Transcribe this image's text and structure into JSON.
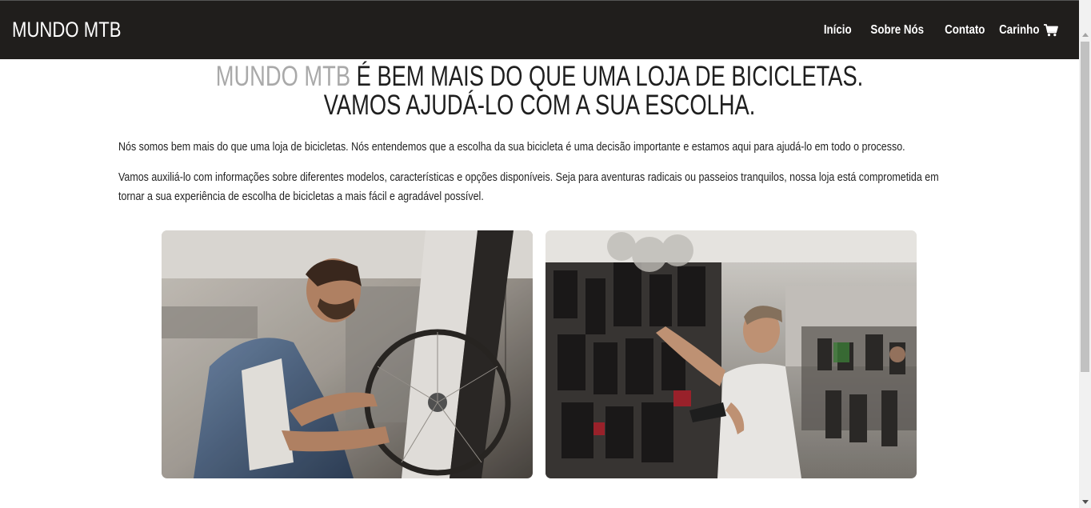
{
  "nav": {
    "brand": "MUNDO MTB",
    "links": [
      "Início",
      "Sobre Nós",
      "Contato"
    ],
    "cart_label": "Carinho",
    "cart_icon": "shopping-cart-icon"
  },
  "hero": {
    "accent": "MUNDO MTB",
    "line1_rest": " É BEM MAIS DO QUE UMA LOJA DE BICICLETAS.",
    "line2": "VAMOS AJUDÁ-LO COM A SUA ESCOLHA."
  },
  "content": {
    "paragraphs": [
      "Nós somos bem mais do que uma loja de bicicletas. Nós entendemos que a escolha da sua bicicleta é uma decisão importante e estamos aqui para ajudá-lo em todo o processo.",
      "Vamos auxiliá-lo com informações sobre diferentes modelos, características e opções disponíveis. Seja para aventuras radicais ou passeios tranquilos, nossa loja está comprometida em tornar a sua experiência de escolha de bicicletas a mais fácil e agradável possível."
    ]
  },
  "colors": {
    "navbar_bg": "#201e1c",
    "accent_text": "#a9a9a9",
    "body_text": "#222222"
  }
}
